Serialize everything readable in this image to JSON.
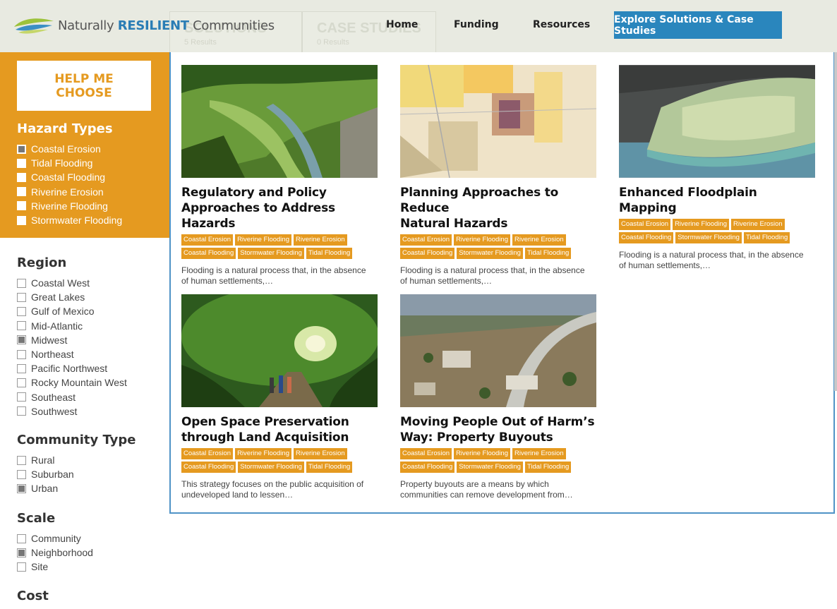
{
  "header": {
    "logo_plain": "Naturally ",
    "logo_bold": "RESILIENT",
    "logo_end": " Communities",
    "nav": [
      "Home",
      "Funding",
      "Resources"
    ],
    "cta": "Explore Solutions & Case Studies"
  },
  "result_tabs": [
    {
      "title": "SOLUTIONS",
      "count": "5 Results"
    },
    {
      "title": "CASE STUDIES",
      "count": "0 Results"
    }
  ],
  "sidebar": {
    "help_line1": "HELP ME",
    "help_line2": "CHOOSE",
    "groups": [
      {
        "title": "Hazard Types",
        "items": [
          {
            "label": "Coastal Erosion",
            "checked": true
          },
          {
            "label": "Tidal Flooding",
            "checked": false
          },
          {
            "label": "Coastal Flooding",
            "checked": false
          },
          {
            "label": "Riverine Erosion",
            "checked": false
          },
          {
            "label": "Riverine Flooding",
            "checked": false
          },
          {
            "label": "Stormwater Flooding",
            "checked": false
          }
        ]
      },
      {
        "title": "Region",
        "items": [
          {
            "label": "Coastal West",
            "checked": false
          },
          {
            "label": "Great Lakes",
            "checked": false
          },
          {
            "label": "Gulf of Mexico",
            "checked": false
          },
          {
            "label": "Mid-Atlantic",
            "checked": false
          },
          {
            "label": "Midwest",
            "checked": true
          },
          {
            "label": "Northeast",
            "checked": false
          },
          {
            "label": "Pacific Northwest",
            "checked": false
          },
          {
            "label": "Rocky Mountain West",
            "checked": false
          },
          {
            "label": "Southeast",
            "checked": false
          },
          {
            "label": "Southwest",
            "checked": false
          }
        ]
      },
      {
        "title": "Community Type",
        "items": [
          {
            "label": "Rural",
            "checked": false
          },
          {
            "label": "Suburban",
            "checked": false
          },
          {
            "label": "Urban",
            "checked": true
          }
        ]
      },
      {
        "title": "Scale",
        "items": [
          {
            "label": "Community",
            "checked": false
          },
          {
            "label": "Neighborhood",
            "checked": true
          },
          {
            "label": "Site",
            "checked": false
          }
        ]
      },
      {
        "title": "Cost",
        "items": []
      }
    ]
  },
  "cards": [
    {
      "title_1": "Regulatory and Policy",
      "title_2": "Approaches to Address Hazards",
      "tags": [
        "Coastal Erosion",
        "Riverine Flooding",
        "Riverine Erosion",
        "Coastal Flooding",
        "Stormwater Flooding",
        "Tidal Flooding"
      ],
      "desc_1": "Flooding is a natural process that, in the absence",
      "desc_2": "of human settlements,…"
    },
    {
      "title_1": "Planning Approaches to Reduce",
      "title_2": "Natural Hazards",
      "tags": [
        "Coastal Erosion",
        "Riverine Flooding",
        "Riverine Erosion",
        "Coastal Flooding",
        "Stormwater Flooding",
        "Tidal Flooding"
      ],
      "desc_1": "Flooding is a natural process that, in the absence",
      "desc_2": "of human settlements,…"
    },
    {
      "title_1": "Enhanced Floodplain Mapping",
      "title_2": "",
      "tags": [
        "Coastal Erosion",
        "Riverine Flooding",
        "Riverine Erosion",
        "Coastal Flooding",
        "Stormwater Flooding",
        "Tidal Flooding"
      ],
      "desc_1": "Flooding is a natural process that, in the absence",
      "desc_2": "of human settlements,…"
    },
    {
      "title_1": "Open Space Preservation",
      "title_2": "through Land Acquisition",
      "tags": [
        "Coastal Erosion",
        "Riverine Flooding",
        "Riverine Erosion",
        "Coastal Flooding",
        "Stormwater Flooding",
        "Tidal Flooding"
      ],
      "desc_1": "This strategy focuses on the public acquisition of",
      "desc_2": "undeveloped land to lessen…"
    },
    {
      "title_1": "Moving People Out of Harm’s",
      "title_2": "Way: Property Buyouts",
      "tags": [
        "Coastal Erosion",
        "Riverine Flooding",
        "Riverine Erosion",
        "Coastal Flooding",
        "Stormwater Flooding",
        "Tidal Flooding"
      ],
      "desc_1": "Property buyouts are a means by which",
      "desc_2": "communities can remove development from…"
    }
  ],
  "colors": {
    "accent_orange": "#e59a20",
    "accent_blue": "#2a86bd",
    "header_bg": "#e8eae1"
  }
}
